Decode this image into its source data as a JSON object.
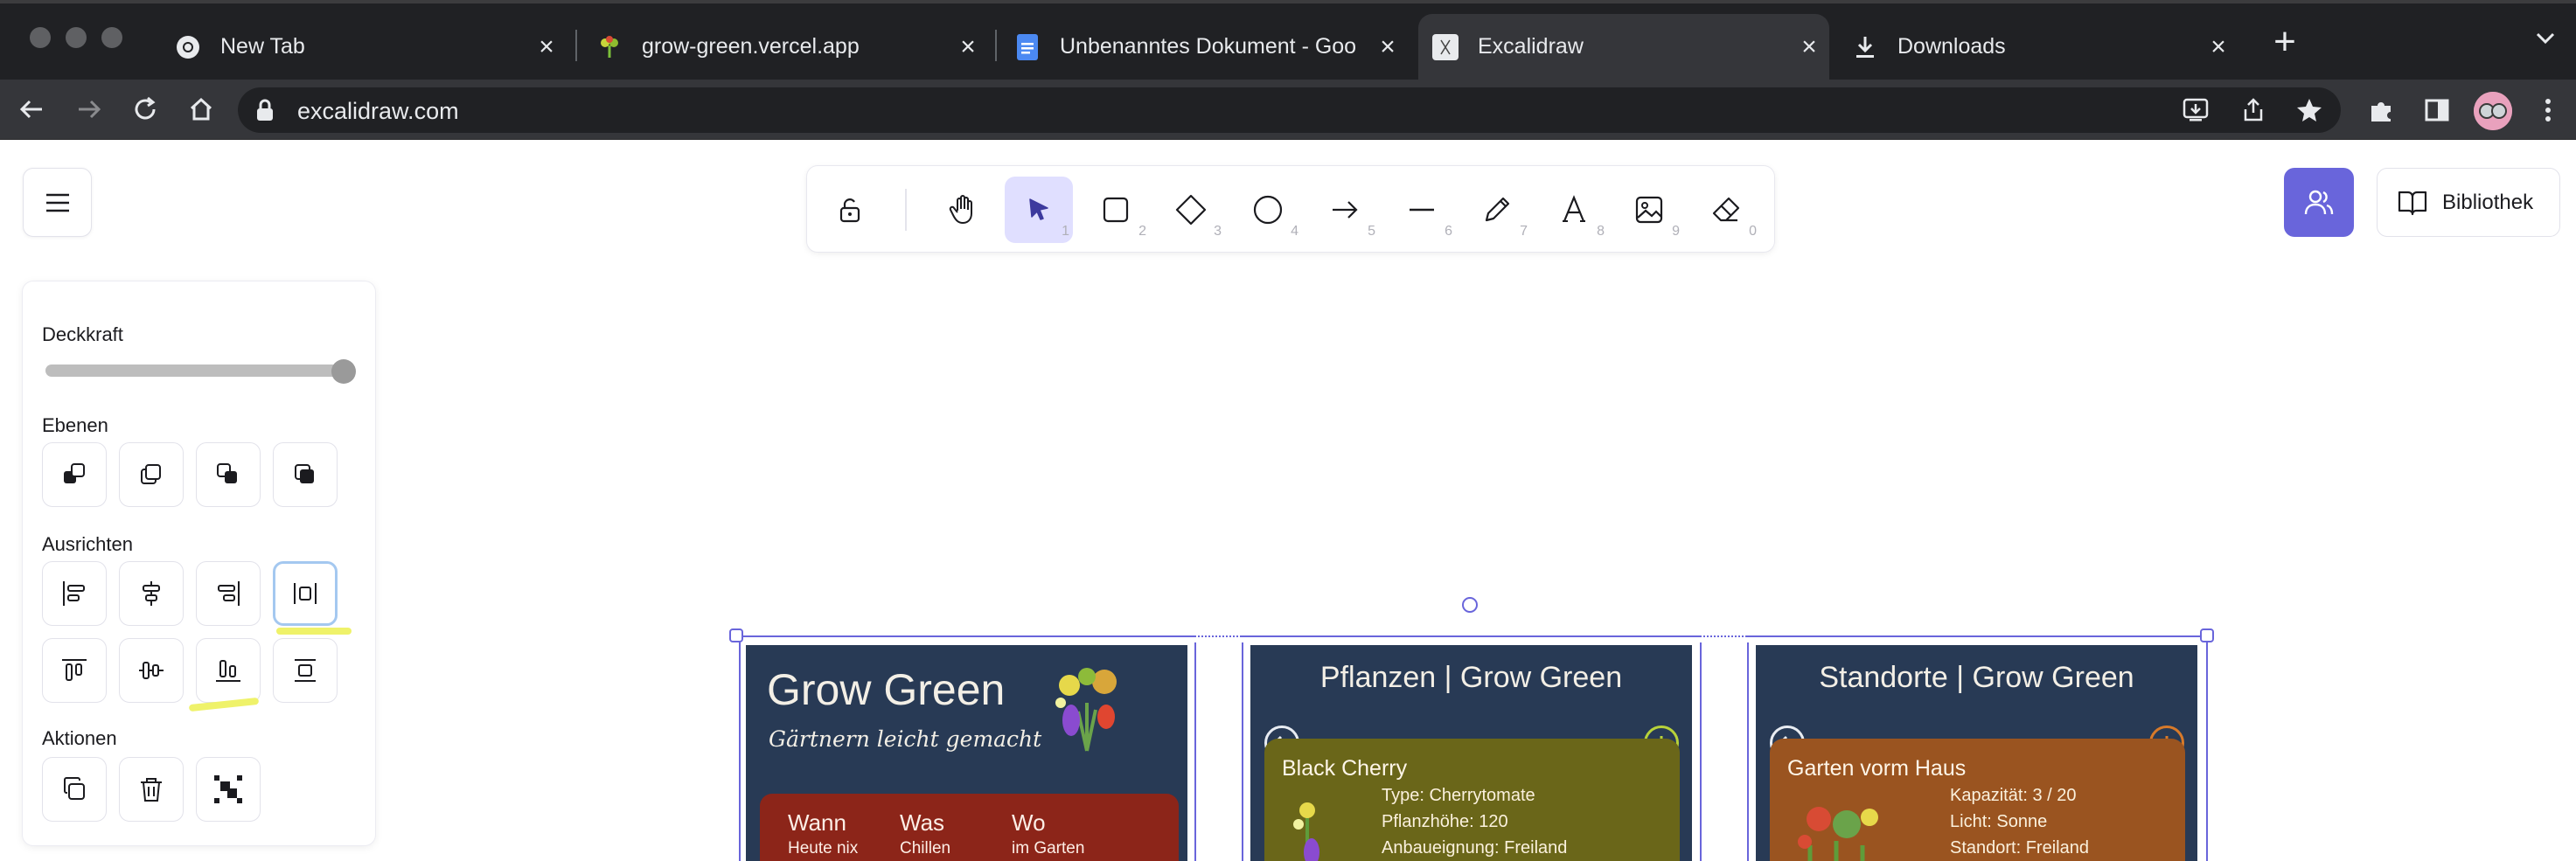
{
  "browser": {
    "tabs": [
      {
        "label": "New Tab",
        "favicon": "chrome-icon"
      },
      {
        "label": "grow-green.vercel.app",
        "favicon": "plant-icon"
      },
      {
        "label": "Unbenanntes Dokument - Goo",
        "favicon": "docs-icon"
      },
      {
        "label": "Excalidraw",
        "favicon": "excalidraw-icon",
        "active": true
      },
      {
        "label": "Downloads",
        "favicon": "download-icon"
      }
    ],
    "url": "excalidraw.com"
  },
  "excalidraw": {
    "tools": [
      {
        "name": "lock",
        "num": ""
      },
      {
        "name": "hand",
        "num": ""
      },
      {
        "name": "selection",
        "num": "1"
      },
      {
        "name": "rectangle",
        "num": "2"
      },
      {
        "name": "diamond",
        "num": "3"
      },
      {
        "name": "ellipse",
        "num": "4"
      },
      {
        "name": "arrow",
        "num": "5"
      },
      {
        "name": "line",
        "num": "6"
      },
      {
        "name": "draw",
        "num": "7"
      },
      {
        "name": "text",
        "num": "8"
      },
      {
        "name": "image",
        "num": "9"
      },
      {
        "name": "eraser",
        "num": "0"
      }
    ],
    "library_label": "Bibliothek",
    "accent": "#6965db"
  },
  "properties": {
    "opacity_label": "Deckkraft",
    "opacity_value": 100,
    "layers_label": "Ebenen",
    "align_label": "Ausrichten",
    "actions_label": "Aktionen"
  },
  "cards": {
    "home": {
      "title": "Grow Green",
      "subtitle": "Gärtnern leicht gemacht",
      "columns": [
        {
          "head": "Wann",
          "value": "Heute nix"
        },
        {
          "head": "Was",
          "value": "Chillen"
        },
        {
          "head": "Wo",
          "value": "im Garten"
        }
      ]
    },
    "plants": {
      "title": "Pflanzen | Grow Green",
      "item_title": "Black Cherry",
      "lines": [
        "Type: Cherrytomate",
        "Pflanzhöhe: 120",
        "Anbaueignung: Freiland"
      ]
    },
    "locations": {
      "title": "Standorte | Grow Green",
      "item_title": "Garten vorm Haus",
      "lines": [
        "Kapazität: 3 / 20",
        "Licht: Sonne",
        "Standort: Freiland"
      ]
    }
  }
}
